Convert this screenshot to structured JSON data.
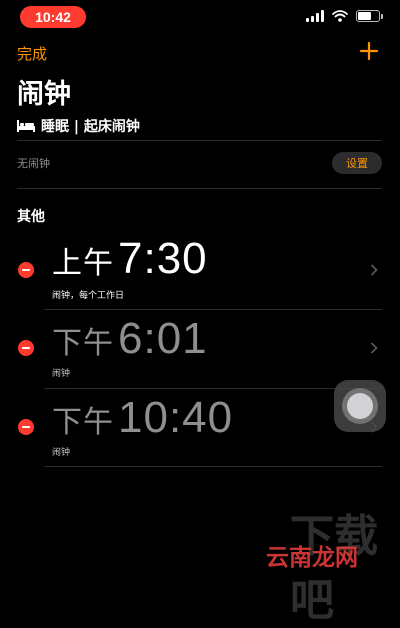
{
  "status_bar": {
    "time": "10:42"
  },
  "header": {
    "done_label": "完成",
    "add_icon": "plus-icon",
    "title": "闹钟"
  },
  "sleep": {
    "icon": "bed-icon",
    "label": "睡眠 | 起床闹钟"
  },
  "no_alarm": {
    "text": "无闹钟",
    "setup_label": "设置"
  },
  "section": {
    "title": "其他"
  },
  "alarms": [
    {
      "ampm": "上午",
      "time": "7:30",
      "label": "闹钟，每个工作日",
      "enabled": true
    },
    {
      "ampm": "下午",
      "time": "6:01",
      "label": "闹钟",
      "enabled": false
    },
    {
      "ampm": "下午",
      "time": "10:40",
      "label": "闹钟",
      "enabled": false
    }
  ],
  "watermark": {
    "text": "云南龙网",
    "faint_text": "下载吧"
  },
  "colors": {
    "accent": "#ff9500",
    "delete": "#ff3b30",
    "background": "#000000"
  }
}
